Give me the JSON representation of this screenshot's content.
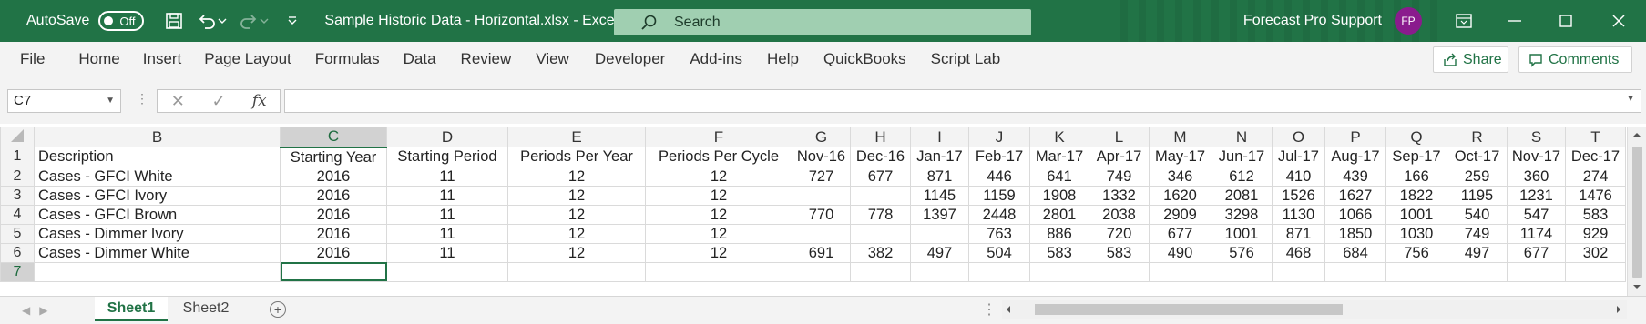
{
  "titlebar": {
    "autosave_label": "AutoSave",
    "autosave_state": "Off",
    "document_title": "Sample Historic Data - Horizontal.xlsx  -  Excel",
    "search_placeholder": "Search",
    "user_name": "Forecast Pro Support",
    "avatar_initials": "FP",
    "accent_color": "#217346"
  },
  "ribbon": {
    "tabs": [
      "File",
      "Home",
      "Insert",
      "Page Layout",
      "Formulas",
      "Data",
      "Review",
      "View",
      "Developer",
      "Add-ins",
      "Help",
      "QuickBooks",
      "Script Lab"
    ],
    "share_label": "Share",
    "comments_label": "Comments"
  },
  "formula_bar": {
    "name_box": "C7",
    "fx_label": "fx",
    "formula": ""
  },
  "sheet": {
    "column_headers": [
      "B",
      "C",
      "D",
      "E",
      "F",
      "G",
      "H",
      "I",
      "J",
      "K",
      "L",
      "M",
      "N",
      "O",
      "P",
      "Q",
      "R",
      "S",
      "T"
    ],
    "selected_column": "C",
    "selected_row": 7,
    "rows": [
      {
        "num": "1",
        "cells": [
          "Description",
          "Starting Year",
          "Starting Period",
          "Periods Per Year",
          "Periods Per Cycle",
          "Nov-16",
          "Dec-16",
          "Jan-17",
          "Feb-17",
          "Mar-17",
          "Apr-17",
          "May-17",
          "Jun-17",
          "Jul-17",
          "Aug-17",
          "Sep-17",
          "Oct-17",
          "Nov-17",
          "Dec-17"
        ]
      },
      {
        "num": "2",
        "cells": [
          "Cases - GFCI White",
          "2016",
          "11",
          "12",
          "12",
          "727",
          "677",
          "871",
          "446",
          "641",
          "749",
          "346",
          "612",
          "410",
          "439",
          "166",
          "259",
          "360",
          "274"
        ]
      },
      {
        "num": "3",
        "cells": [
          "Cases - GFCI Ivory",
          "2016",
          "11",
          "12",
          "12",
          "",
          "",
          "1145",
          "1159",
          "1908",
          "1332",
          "1620",
          "2081",
          "1526",
          "1627",
          "1822",
          "1195",
          "1231",
          "1476"
        ]
      },
      {
        "num": "4",
        "cells": [
          "Cases - GFCI Brown",
          "2016",
          "11",
          "12",
          "12",
          "770",
          "778",
          "1397",
          "2448",
          "2801",
          "2038",
          "2909",
          "3298",
          "1130",
          "1066",
          "1001",
          "540",
          "547",
          "583"
        ]
      },
      {
        "num": "5",
        "cells": [
          "Cases - Dimmer Ivory",
          "2016",
          "11",
          "12",
          "12",
          "",
          "",
          "",
          "763",
          "886",
          "720",
          "677",
          "1001",
          "871",
          "1850",
          "1030",
          "749",
          "1174",
          "929"
        ]
      },
      {
        "num": "6",
        "cells": [
          "Cases - Dimmer White",
          "2016",
          "11",
          "12",
          "12",
          "691",
          "382",
          "497",
          "504",
          "583",
          "583",
          "490",
          "576",
          "468",
          "684",
          "756",
          "497",
          "677",
          "302"
        ]
      },
      {
        "num": "7",
        "cells": [
          "",
          "",
          "",
          "",
          "",
          "",
          "",
          "",
          "",
          "",
          "",
          "",
          "",
          "",
          "",
          "",
          "",
          "",
          ""
        ]
      }
    ]
  },
  "sheet_tabs": [
    "Sheet1",
    "Sheet2"
  ],
  "active_sheet": "Sheet1"
}
